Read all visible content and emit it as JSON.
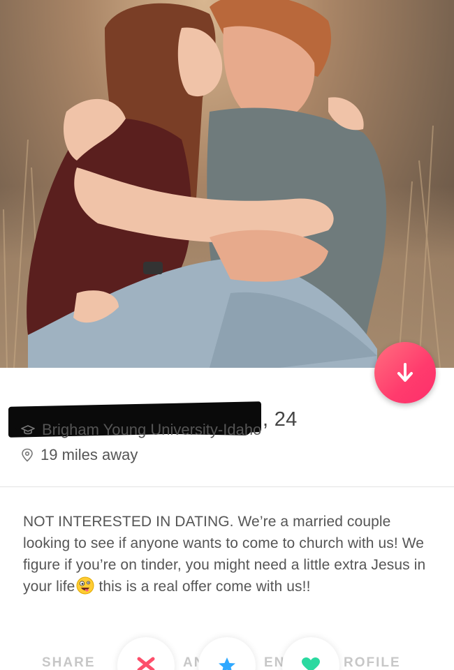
{
  "profile": {
    "age_text": ", 24",
    "school": "Brigham Young University-Idaho",
    "distance": "19 miles away",
    "bio": "NOT INTERESTED IN DATING. We’re a married couple looking to see if anyone wants to come to church with us! We figure if you’re on tinder, you might need a little extra Jesus in your life",
    "bio_tail": "this is a real offer come with us!!"
  },
  "icons": {
    "school_icon": "graduation-cap-icon",
    "location_icon": "location-pin-icon",
    "fab_icon": "arrow-down-icon",
    "emoji": "zany-face-emoji"
  },
  "actions": {
    "share_label": "SHARE",
    "left_label": "AN",
    "right_label": "EN",
    "profile_label": "ROFILE"
  },
  "colors": {
    "accent_pink": "#fd3a73",
    "nope_red": "#fd4f6b",
    "superlike_blue": "#2ea8ff",
    "like_green": "#2bd9a0"
  }
}
